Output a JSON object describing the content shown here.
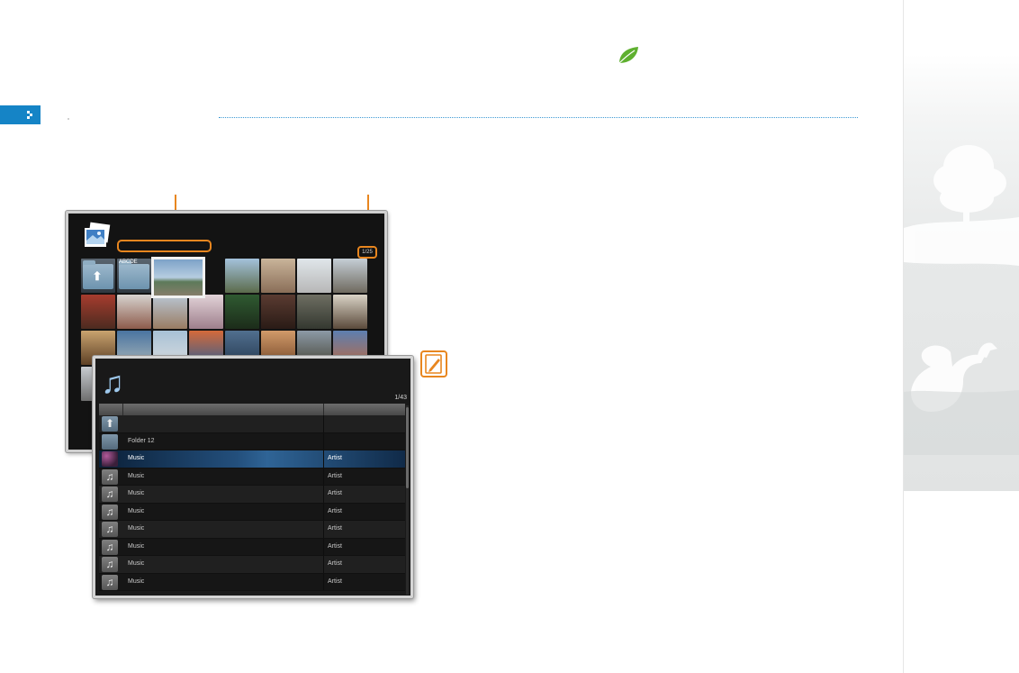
{
  "photo_browser": {
    "counter": "1/25",
    "folders": [
      {
        "icon": "folder-up-icon",
        "name": ""
      },
      {
        "icon": "folder-icon",
        "name": "ABCDE"
      }
    ],
    "thumbnail_count": 30
  },
  "music_list": {
    "counter": "1/43",
    "rows": [
      {
        "icon": "folder-up-icon",
        "title": "",
        "artist": "",
        "selected": false
      },
      {
        "icon": "folder-icon",
        "title": "Folder 12",
        "artist": "",
        "selected": false
      },
      {
        "icon": "album-art-icon",
        "title": "Music",
        "artist": "Artist",
        "selected": true
      },
      {
        "icon": "music-note-icon",
        "title": "Music",
        "artist": "Artist",
        "selected": false
      },
      {
        "icon": "music-note-icon",
        "title": "Music",
        "artist": "Artist",
        "selected": false
      },
      {
        "icon": "music-note-icon",
        "title": "Music",
        "artist": "Artist",
        "selected": false
      },
      {
        "icon": "music-note-icon",
        "title": "Music",
        "artist": "Artist",
        "selected": false
      },
      {
        "icon": "music-note-icon",
        "title": "Music",
        "artist": "Artist",
        "selected": false
      },
      {
        "icon": "music-note-icon",
        "title": "Music",
        "artist": "Artist",
        "selected": false
      },
      {
        "icon": "music-note-icon",
        "title": "Music",
        "artist": "Artist",
        "selected": false
      }
    ]
  },
  "colors": {
    "accent_blue": "#1584c6",
    "callout_orange": "#e8861f",
    "leaf_green": "#5fb030",
    "selection_blue": "#2f6496"
  }
}
